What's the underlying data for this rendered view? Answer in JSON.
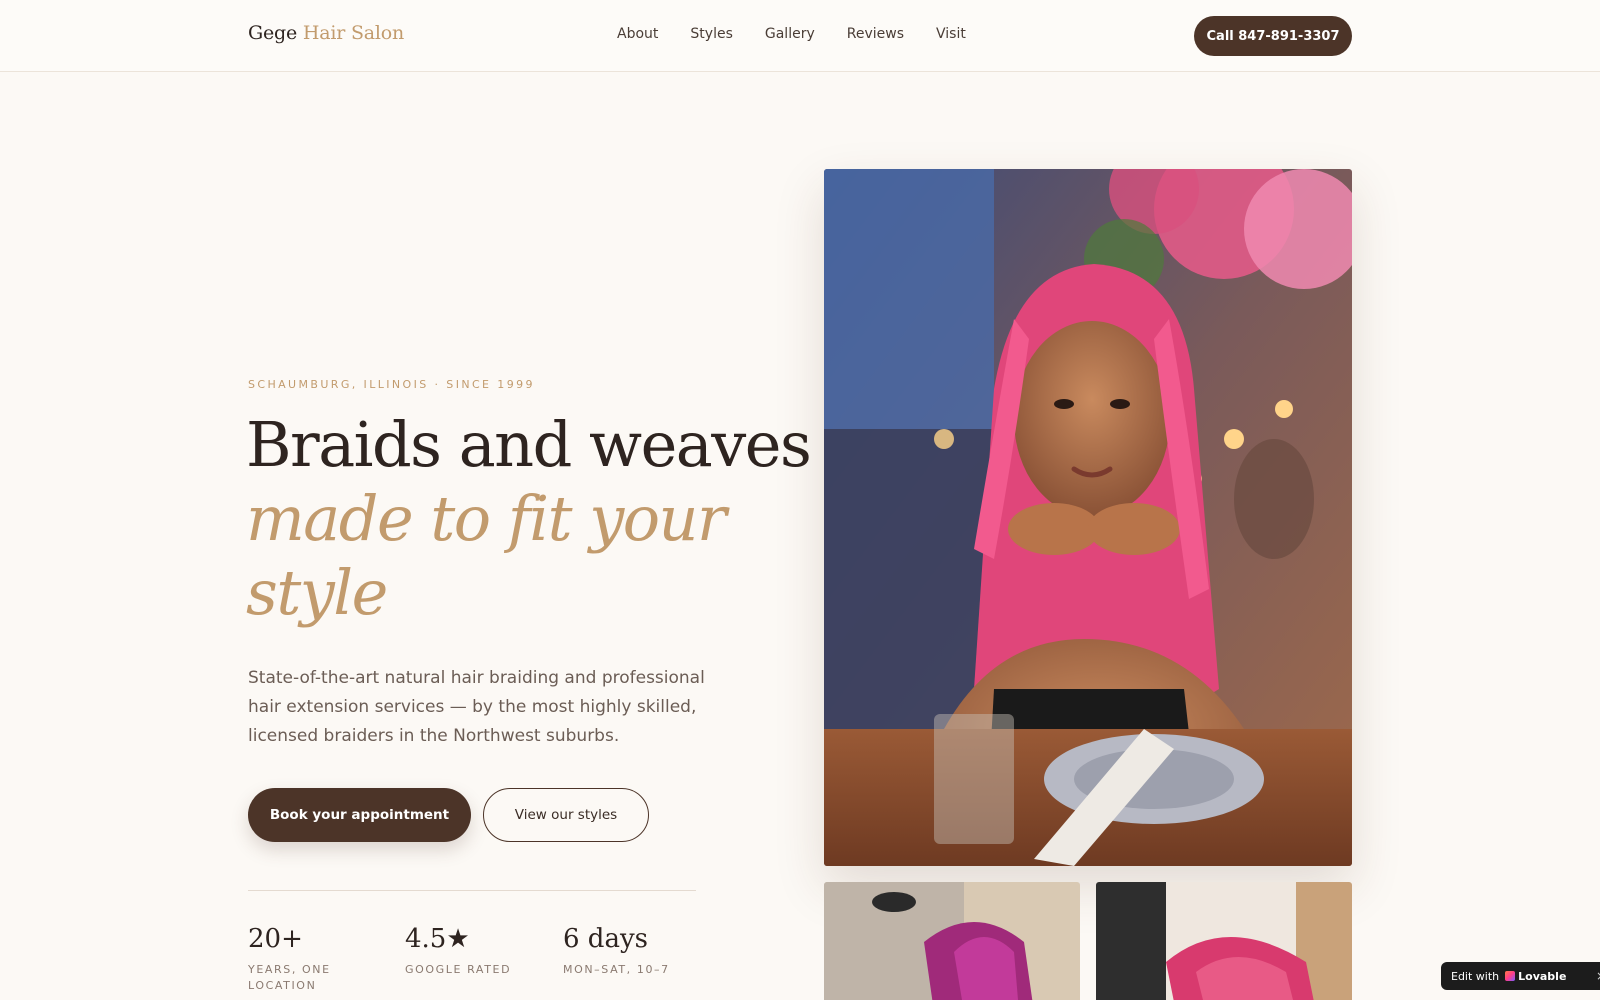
{
  "header": {
    "logo_brand": "Gege",
    "logo_accent": "Hair Salon",
    "nav": [
      "About",
      "Styles",
      "Gallery",
      "Reviews",
      "Visit"
    ],
    "call_label": "Call 847-891-3307"
  },
  "hero": {
    "eyebrow": "SCHAUMBURG, ILLINOIS · SINCE 1999",
    "headline_line1": "Braids and weaves",
    "headline_line2": "made to fit your style",
    "lede": "State-of-the-art natural hair braiding and professional hair extension services — by the most highly skilled, licensed braiders in the Northwest suburbs.",
    "primary_cta": "Book your appointment",
    "secondary_cta": "View our styles",
    "stats": [
      {
        "value": "20+",
        "label": "YEARS, ONE LOCATION"
      },
      {
        "value": "4.5★",
        "label": "GOOGLE RATED"
      },
      {
        "value": "6 days",
        "label": "MON–SAT, 10–7"
      }
    ]
  },
  "badge": {
    "prefix": "Edit with",
    "brand": "Lovable",
    "close": "×"
  },
  "colors": {
    "accent": "#c29b6d",
    "primary": "#4c3428",
    "background": "#fcf9f5"
  }
}
